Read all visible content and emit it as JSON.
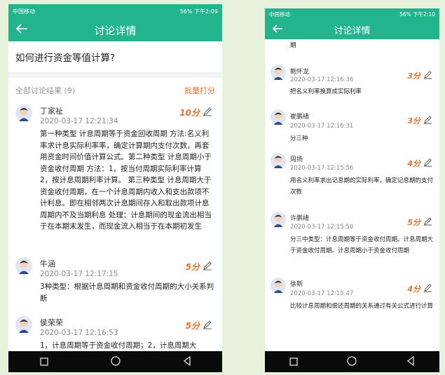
{
  "phone1": {
    "status": {
      "left": "中国移动",
      "right": "56% 下午2:09"
    },
    "title": "讨论详情",
    "question": "如何进行资金等值计算?",
    "list_count": "全部讨论结果 (9)",
    "batch_score": "批量打分",
    "items": [
      {
        "name": "丁家祉",
        "time": "2020-03-17 12:21:34",
        "score": "10分",
        "text": "第一种类型 计息周期等于资金回收周期 方法:名义利率求计息实际利率率，确定计算期内支付次数，再套用资金时间价值计算公式。第二种类型 计息周期小于资金收付周期 方法：1，按当付周期实际利率计算 2，按计息周期利率计算。 第三种类型 计息周期大于资金收付周期，在一个计息周期内收入和支出款项不计利息。即在相邻两次计息期间存入和取出款项计息周期内不及当期利息 处理：计息期间的现金流出相当于在本期末发生，而现金流入相当于在本期初发生"
      },
      {
        "name": "牛涵",
        "time": "2020-03-17 12:17:15",
        "score": "5分",
        "text": "3种类型：根据计息周期和资金收付周期的大小关系判断"
      },
      {
        "name": "侯荣荣",
        "time": "2020-03-17 12:16:53",
        "score": "5分",
        "text": "1，计息周期等于资金收付周期；2，计息周期大"
      }
    ]
  },
  "phone2": {
    "status": {
      "left": "中国移动",
      "right": "56% 下午2:10"
    },
    "title": "讨论详情",
    "top_fragment": "期",
    "items": [
      {
        "name": "鲍怀龙",
        "time": "2020-03-17 12:16:36",
        "score": "3分",
        "text": "把名义利率换算成实际利率"
      },
      {
        "name": "崔鹏绪",
        "time": "2020-03-17 12:16:31",
        "score": "3分",
        "text": "分三种"
      },
      {
        "name": "周扬",
        "time": "2020-03-17 12:15:56",
        "score": "4分",
        "text": "用名义利率求出记息期的实际利率，确定记息期的支付次数"
      },
      {
        "name": "许鹏绪",
        "time": "2020-03-17 12:15:50",
        "score": "5分",
        "text": "分三中类型：计息周期等于资金收付周期。计息周期大于资金收付周期。计息周期小于资金收付周期"
      },
      {
        "name": "徐新",
        "time": "2020-03-17 12:15:47",
        "score": "4分",
        "text": "比较计息周期和偿还周期的关系通过有关公式进行计算"
      }
    ]
  },
  "colors": {
    "primary": "#22b48d",
    "accent": "#e8722a"
  }
}
